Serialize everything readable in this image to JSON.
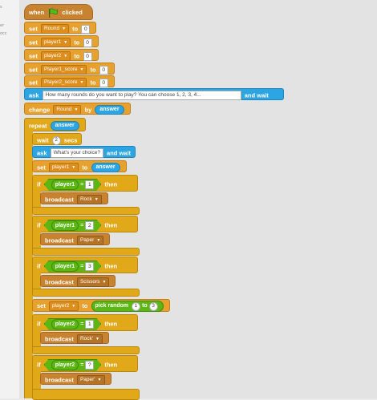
{
  "stage_labels": [
    "s",
    "er",
    "occ"
  ],
  "script": {
    "when_label": "when",
    "clicked_label": "clicked",
    "flag_icon": "green-flag-icon",
    "set_label": "set",
    "to_label": "to",
    "ask_label": "ask",
    "and_wait_label": "and wait",
    "change_label": "change",
    "by_label": "by",
    "answer_label": "answer",
    "repeat_label": "repeat",
    "wait_label": "wait",
    "secs_label": "secs",
    "if_label": "if",
    "then_label": "then",
    "broadcast_label": "broadcast",
    "pick_random_label": "pick random",
    "var_round": "Round",
    "var_player1": "player1",
    "var_player2": "player2",
    "var_player1_score": "Player1_score",
    "var_player2_score": "Player2_score",
    "zero": "0",
    "ask_rounds_text": "How many rounds do you want to play? You can choose 1, 2, 3, 4...",
    "wait_secs": "2",
    "ask_choice_text": "What's your choice?",
    "one": "1",
    "two": "2",
    "three": "3",
    "msg_rock": "Rock",
    "msg_paper": "Paper",
    "msg_scissors": "Scissors",
    "msg_rock2": "Rock'",
    "msg_paper2": "Paper'",
    "qmark": "?"
  }
}
